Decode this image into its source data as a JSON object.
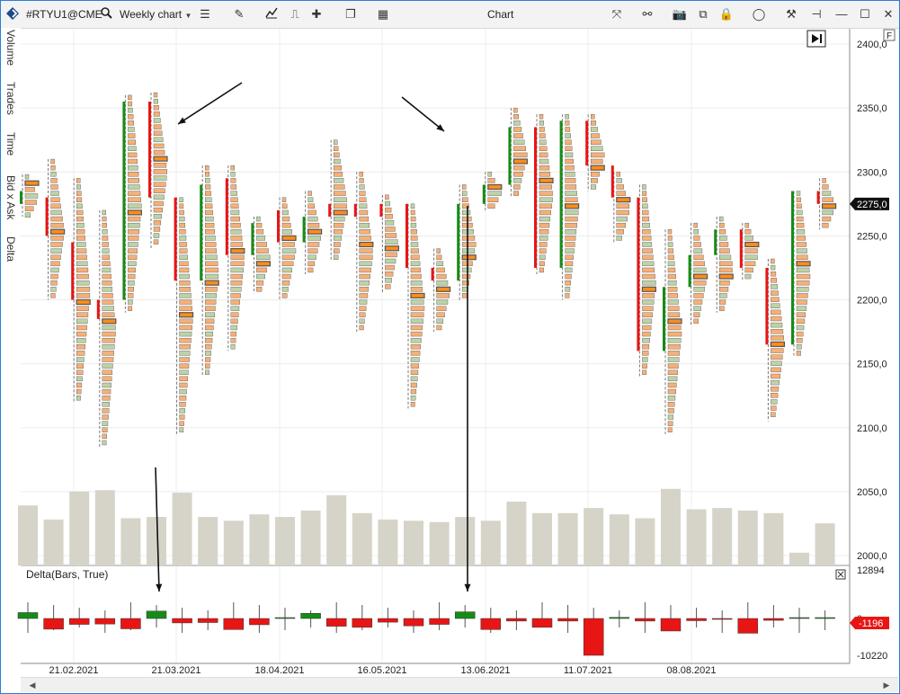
{
  "toolbar": {
    "symbol": "#RTYU1@CME",
    "chart_period": "Weekly chart",
    "window_title": "Chart",
    "icons": [
      "app-logo-icon",
      "search-icon",
      "chart-type-icon",
      "pencil-icon",
      "indicator-icon",
      "template-icon",
      "crosshair-icon",
      "window-icon",
      "panel-icon",
      "zoom-icon",
      "link-icon",
      "eye-icon",
      "camera-icon",
      "copy-icon",
      "lock-icon",
      "color-circle-icon",
      "tools-icon",
      "pin-icon",
      "minimize-icon",
      "maximize-icon",
      "close-icon"
    ]
  },
  "sidebar": {
    "tabs": [
      "Volume",
      "Trades",
      "Time",
      "Bid x Ask",
      "Delta"
    ]
  },
  "chart": {
    "f_label": "F",
    "price_labels": [
      "2400,0",
      "2350,0",
      "2300,0",
      "2250,0",
      "2200,0",
      "2150,0",
      "2100,0",
      "2050,0",
      "2000,0"
    ],
    "current_price": "2275,0",
    "date_labels": [
      "21.02.2021",
      "21.03.2021",
      "18.04.2021",
      "16.05.2021",
      "13.06.2021",
      "11.07.2021",
      "08.08.2021"
    ],
    "delta_title": "Delta(Bars, True)",
    "delta_labels": [
      "12894",
      "0",
      "-10220"
    ],
    "current_delta": "-1196",
    "colors": {
      "up": "#178b17",
      "down": "#e81515",
      "volume": "#d6d4c8",
      "ask": "#f5b078",
      "bid": "#bcd2a8",
      "poc": "#ff8c1a"
    }
  },
  "chart_data": {
    "type": "candlestick-footprint",
    "x_labels": [
      "21.02.2021",
      "21.03.2021",
      "18.04.2021",
      "16.05.2021",
      "13.06.2021",
      "11.07.2021",
      "08.08.2021"
    ],
    "ylim": [
      1990,
      2410
    ],
    "ohlc": [
      {
        "o": 2275,
        "h": 2298,
        "l": 2265,
        "c": 2285
      },
      {
        "o": 2280,
        "h": 2310,
        "l": 2200,
        "c": 2250
      },
      {
        "o": 2245,
        "h": 2295,
        "l": 2120,
        "c": 2200
      },
      {
        "o": 2200,
        "h": 2270,
        "l": 2085,
        "c": 2185
      },
      {
        "o": 2200,
        "h": 2360,
        "l": 2190,
        "c": 2355
      },
      {
        "o": 2355,
        "h": 2362,
        "l": 2240,
        "c": 2280
      },
      {
        "o": 2280,
        "h": 2280,
        "l": 2095,
        "c": 2215
      },
      {
        "o": 2215,
        "h": 2305,
        "l": 2140,
        "c": 2290
      },
      {
        "o": 2295,
        "h": 2305,
        "l": 2160,
        "c": 2235
      },
      {
        "o": 2235,
        "h": 2265,
        "l": 2205,
        "c": 2260
      },
      {
        "o": 2270,
        "h": 2280,
        "l": 2200,
        "c": 2245
      },
      {
        "o": 2245,
        "h": 2285,
        "l": 2220,
        "c": 2265
      },
      {
        "o": 2275,
        "h": 2325,
        "l": 2230,
        "c": 2265
      },
      {
        "o": 2275,
        "h": 2300,
        "l": 2175,
        "c": 2265
      },
      {
        "o": 2275,
        "h": 2282,
        "l": 2205,
        "c": 2265
      },
      {
        "o": 2275,
        "h": 2275,
        "l": 2115,
        "c": 2225
      },
      {
        "o": 2225,
        "h": 2240,
        "l": 2175,
        "c": 2215
      },
      {
        "o": 2215,
        "h": 2290,
        "l": 2200,
        "c": 2275
      },
      {
        "o": 2275,
        "h": 2300,
        "l": 2270,
        "c": 2290
      },
      {
        "o": 2290,
        "h": 2350,
        "l": 2280,
        "c": 2335
      },
      {
        "o": 2335,
        "h": 2345,
        "l": 2220,
        "c": 2225
      },
      {
        "o": 2225,
        "h": 2345,
        "l": 2200,
        "c": 2340
      },
      {
        "o": 2340,
        "h": 2345,
        "l": 2285,
        "c": 2305
      },
      {
        "o": 2305,
        "h": 2300,
        "l": 2245,
        "c": 2280
      },
      {
        "o": 2280,
        "h": 2290,
        "l": 2140,
        "c": 2160
      },
      {
        "o": 2160,
        "h": 2255,
        "l": 2095,
        "c": 2210
      },
      {
        "o": 2210,
        "h": 2260,
        "l": 2180,
        "c": 2235
      },
      {
        "o": 2235,
        "h": 2265,
        "l": 2190,
        "c": 2255
      },
      {
        "o": 2255,
        "h": 2260,
        "l": 2215,
        "c": 2225
      },
      {
        "o": 2225,
        "h": 2232,
        "l": 2105,
        "c": 2165
      },
      {
        "o": 2165,
        "h": 2285,
        "l": 2155,
        "c": 2285
      },
      {
        "o": 2285,
        "h": 2295,
        "l": 2255,
        "c": 2275
      }
    ],
    "volume": [
      47,
      36,
      58,
      59,
      37,
      38,
      57,
      38,
      35,
      40,
      38,
      43,
      55,
      41,
      36,
      35,
      34,
      38,
      35,
      50,
      41,
      41,
      45,
      40,
      37,
      60,
      44,
      45,
      43,
      41,
      10,
      33
    ],
    "delta": [
      1600,
      -2900,
      -1600,
      -1500,
      -2800,
      2000,
      -1200,
      -1100,
      -3000,
      -1700,
      0,
      1400,
      -2100,
      -2400,
      -1000,
      -2000,
      -1600,
      1800,
      -3000,
      -700,
      -2400,
      -700,
      -10000,
      300,
      -700,
      -3400,
      -600,
      -200,
      -4000,
      -500,
      0,
      0
    ]
  }
}
